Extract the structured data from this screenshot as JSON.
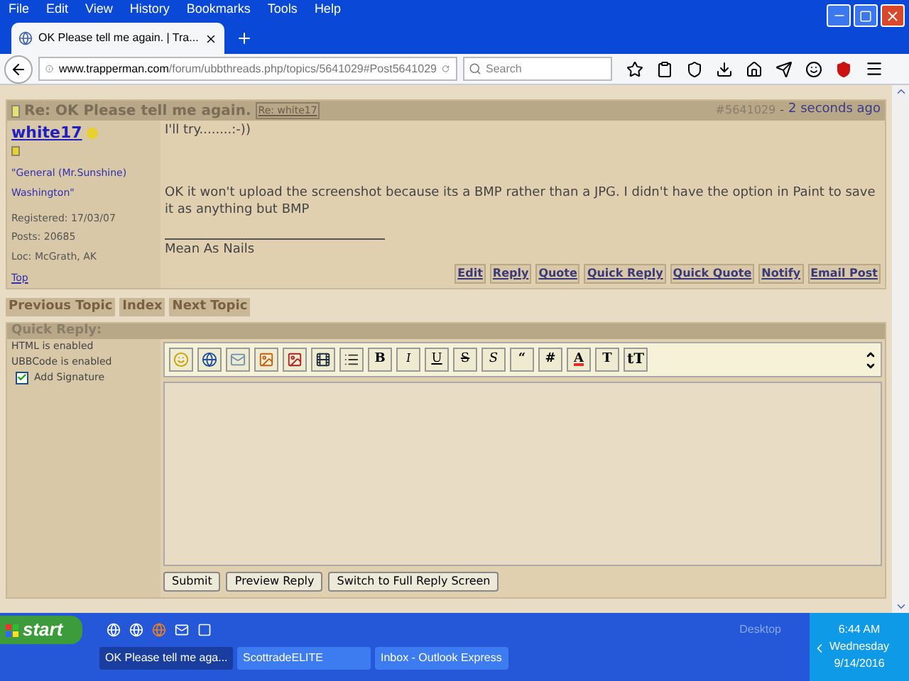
{
  "menu": [
    "File",
    "Edit",
    "View",
    "History",
    "Bookmarks",
    "Tools",
    "Help"
  ],
  "tab": {
    "title": "OK Please tell me again. | Tra...",
    "selected": true
  },
  "url": {
    "host": "www.trapperman.com",
    "path": "/forum/ubbthreads.php/topics/5641029#Post5641029"
  },
  "search": {
    "placeholder": "Search"
  },
  "post": {
    "title": "Re: OK Please tell me again.",
    "reply_to": "Re: white17",
    "number": "#5641029",
    "separator": "-",
    "time": "2 seconds ago",
    "author": "white17",
    "title_line1": "\"General (Mr.Sunshine)",
    "title_line2": "Washington\"",
    "registered": "Registered: 17/03/07",
    "posts": "Posts: 20685",
    "location": "Loc: McGrath, AK",
    "top": "Top",
    "paragraphs": [
      "I'll try........:-))",
      "OK it won't upload the screenshot because its a BMP rather than a JPG. I didn't have the option in Paint to save it as anything but BMP"
    ],
    "signature": "Mean As Nails",
    "actions": [
      "Edit",
      "Reply",
      "Quote",
      "Quick Reply",
      "Quick Quote",
      "Notify",
      "Email Post"
    ]
  },
  "topic_nav": [
    "Previous Topic",
    "Index",
    "Next Topic"
  ],
  "quick_reply": {
    "title": "Quick Reply:",
    "html": "HTML is enabled",
    "ubb": "UBBCode is enabled",
    "add_signature": {
      "label": "Add Signature",
      "checked": true
    },
    "format_buttons": [
      {
        "label": "B",
        "kind": "bold"
      },
      {
        "label": "I",
        "kind": "italic"
      },
      {
        "label": "U",
        "kind": "underline"
      },
      {
        "label": "S",
        "kind": "strike"
      },
      {
        "label": "S",
        "kind": "slant"
      },
      {
        "label": "“",
        "kind": "plain"
      },
      {
        "label": "#",
        "kind": "plain"
      },
      {
        "label": "A",
        "kind": "color"
      },
      {
        "label": "T",
        "kind": "plain"
      },
      {
        "label": "tT",
        "kind": "small"
      }
    ],
    "buttons": [
      "Submit",
      "Preview Reply",
      "Switch to Full Reply Screen"
    ]
  },
  "taskbar": {
    "start": "start",
    "tasks": [
      {
        "label": "OK Please tell me aga...",
        "selected": true
      },
      {
        "label": "ScottradeELITE",
        "selected": false
      },
      {
        "label": "Inbox - Outlook Express",
        "selected": false
      }
    ],
    "desktop": "Desktop",
    "time": "6:44 AM",
    "day": "Wednesday",
    "date": "9/14/2016"
  }
}
